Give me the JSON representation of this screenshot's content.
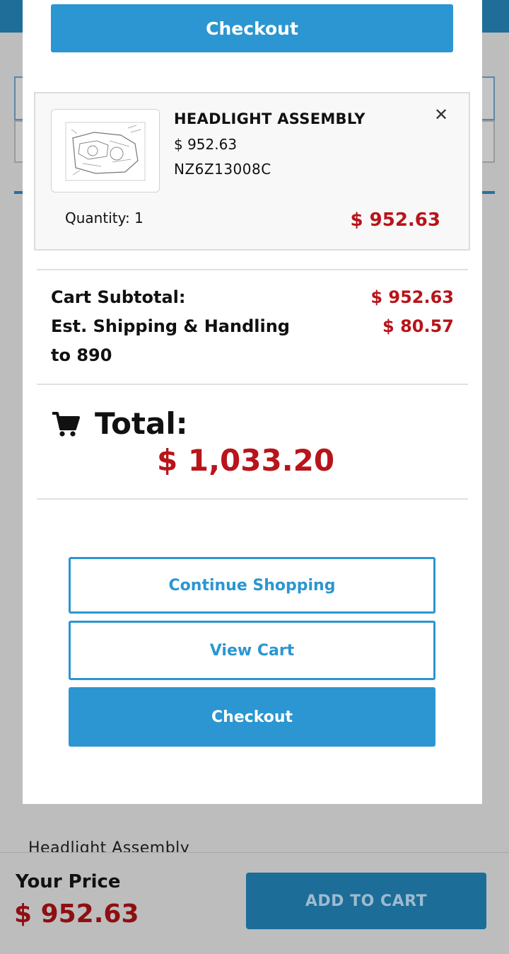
{
  "background": {
    "text": "Headlight Assembly"
  },
  "bottom_bar": {
    "your_price_label": "Your Price",
    "your_price_value": "$ 952.63",
    "add_to_cart_label": "ADD TO CART"
  },
  "modal": {
    "checkout_top_label": "Checkout",
    "item": {
      "name": "HEADLIGHT ASSEMBLY",
      "price": "$ 952.63",
      "sku": "NZ6Z13008C",
      "quantity": "Quantity: 1",
      "line_total": "$ 952.63",
      "remove_icon": "close-icon"
    },
    "summary": {
      "subtotal_label": "Cart Subtotal:",
      "subtotal_value": "$ 952.63",
      "shipping_label": "Est. Shipping & Handling to 890",
      "shipping_value": "$ 80.57"
    },
    "total": {
      "icon": "cart-icon",
      "label": "Total:",
      "value": "$ 1,033.20"
    },
    "buttons": {
      "continue_shopping": "Continue Shopping",
      "view_cart": "View Cart",
      "checkout": "Checkout"
    }
  },
  "colors": {
    "accent": "#2b96d1",
    "price_red": "#b8141a",
    "header_blue": "#1f6d99"
  }
}
